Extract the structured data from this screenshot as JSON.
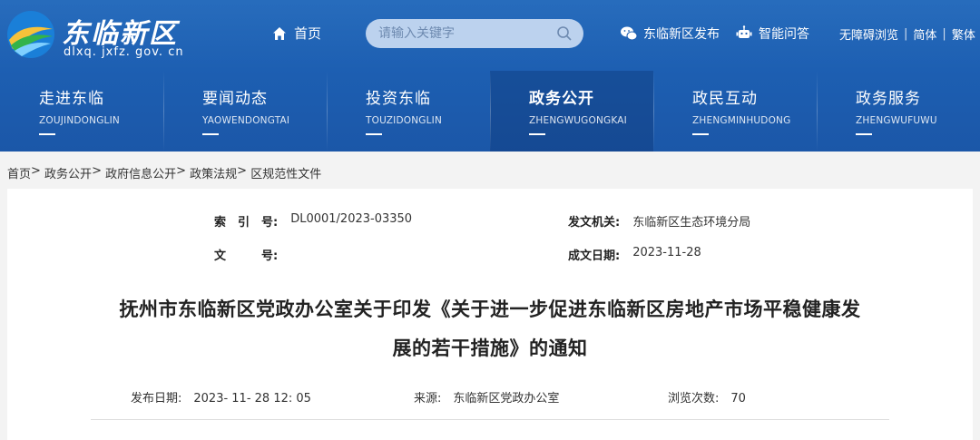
{
  "header": {
    "logo_title": "东临新区",
    "logo_domain": "dlxq. jxfz. gov. cn",
    "home_label": "首页",
    "search_placeholder": "请输入关键字",
    "links": {
      "publish": "东临新区发布",
      "qa": "智能问答",
      "accessibility": "无障碍浏览",
      "simplified": "简体",
      "traditional": "繁体"
    }
  },
  "nav": [
    {
      "zh": "走进东临",
      "py": "ZOUJINDONGLIN"
    },
    {
      "zh": "要闻动态",
      "py": "YAOWENDONGTAI"
    },
    {
      "zh": "投资东临",
      "py": "TOUZIDONGLIN"
    },
    {
      "zh": "政务公开",
      "py": "ZHENGWUGONGKAI"
    },
    {
      "zh": "政民互动",
      "py": "ZHENGMINHUDONG"
    },
    {
      "zh": "政务服务",
      "py": "ZHENGWUFUWU"
    }
  ],
  "breadcrumb": [
    "首页",
    "政务公开",
    "政府信息公开",
    "政策法规",
    "区规范性文件"
  ],
  "meta": {
    "index_label": "索　引　号:",
    "index_value": "DL0001/2023-03350",
    "doc_label": "文　　　号:",
    "doc_value": "",
    "issuer_label": "发文机关:",
    "issuer_value": "东临新区生态环境分局",
    "date_label": "成文日期:",
    "date_value": "2023-11-28"
  },
  "article": {
    "title_line1": "抚州市东临新区党政办公室关于印发《关于进一步促进东临新区房地产市场平稳健康发",
    "title_line2": "展的若干措施》的通知",
    "publish_date": "发布日期:　2023- 11- 28 12: 05",
    "source": "来源:　东临新区党政办公室",
    "views": "浏览次数:　70"
  },
  "colors": {
    "header_blue": "#1d5fb2",
    "search_bg": "#bcd2ee"
  }
}
